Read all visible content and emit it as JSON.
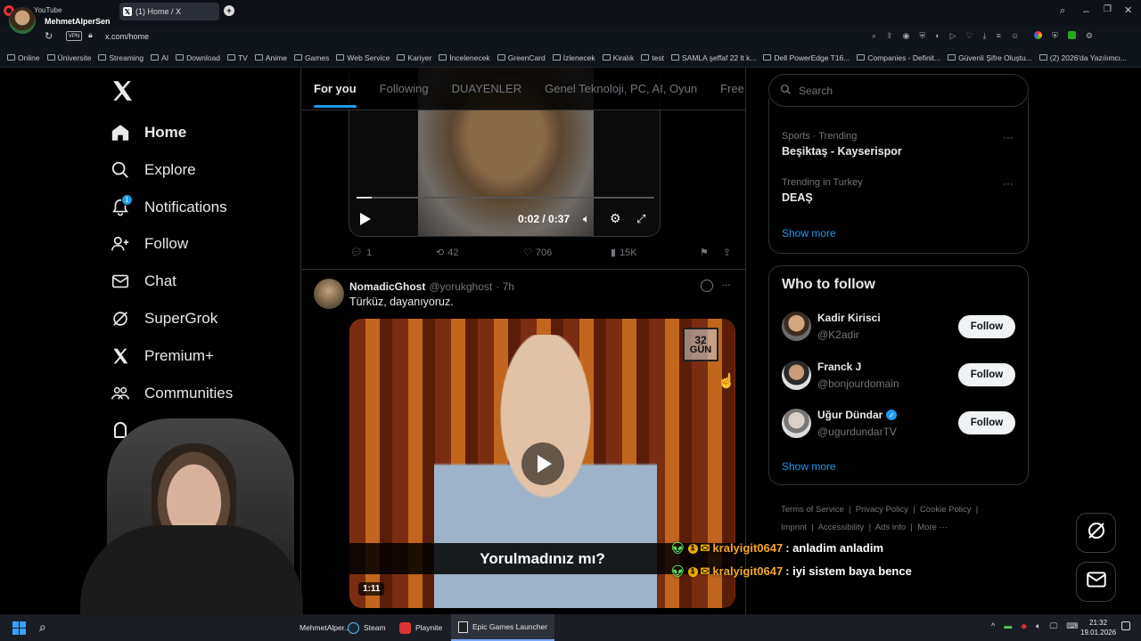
{
  "browser": {
    "profile_top": "YouTube",
    "profile_name": "MehmetAlperSen",
    "tab_title": "(1) Home / X",
    "vpn_badge": "VPN",
    "url": "x.com/home",
    "bookmarks": [
      "Online",
      "Üniversite",
      "Streaming",
      "AI",
      "Download",
      "TV",
      "Anime",
      "Games",
      "Web Service",
      "Kariyer",
      "İncelenecek",
      "GreenCard",
      "İzlenecek",
      "Kiralık",
      "test",
      "SAMLA şeffaf 22 lt k...",
      "Dell PowerEdge T16...",
      "Companies - Definit...",
      "Güvenli Şifre Oluştu...",
      "(2) 2026'da Yazılımcı..."
    ]
  },
  "sidebar": {
    "items": [
      {
        "label": "Home",
        "icon": "home-icon"
      },
      {
        "label": "Explore",
        "icon": "search-icon"
      },
      {
        "label": "Notifications",
        "icon": "bell-icon",
        "badge": "1"
      },
      {
        "label": "Follow",
        "icon": "person-add-icon"
      },
      {
        "label": "Chat",
        "icon": "mail-icon"
      },
      {
        "label": "SuperGrok",
        "icon": "grok-icon"
      },
      {
        "label": "Premium+",
        "icon": "x-logo-icon"
      },
      {
        "label": "Communities",
        "icon": "people-icon"
      }
    ]
  },
  "timeline": {
    "tabs": [
      "For you",
      "Following",
      "DUAYENLER",
      "Genel Teknoloji, PC, AI, Oyun",
      "Free G"
    ],
    "video1": {
      "time": "0:02 / 0:37",
      "progress": 0.05
    },
    "post1_stats": {
      "replies": "1",
      "reposts": "42",
      "likes": "706",
      "views": "15K"
    },
    "post2": {
      "author": "NomadicGhost",
      "handle": "@yorukghost",
      "time": "· 7h",
      "text": "Türküz, dayanıyoruz.",
      "video_caption": "Yorulmadınız mı?",
      "video_logo_top": "32",
      "video_logo_bottom": "GÜN",
      "duration": "1:11"
    }
  },
  "right": {
    "search_placeholder": "Search",
    "trends": [
      {
        "category": "Sports · Trending",
        "name": "Beşiktaş - Kayserispor"
      },
      {
        "category": "Trending in Turkey",
        "name": "DEAŞ"
      }
    ],
    "trends_more": "Show more",
    "who_to_follow_title": "Who to follow",
    "suggestions": [
      {
        "name": "Kadir Kirisci",
        "handle": "@K2adir",
        "button": "Follow",
        "verified": false
      },
      {
        "name": "Franck J",
        "handle": "@bonjourdomain",
        "button": "Follow",
        "verified": false
      },
      {
        "name": "Uğur Dündar",
        "handle": "@ugurdundarTV",
        "button": "Follow",
        "verified": true
      }
    ],
    "follow_more": "Show more",
    "footer_links": [
      "Terms of Service",
      "Privacy Policy",
      "Cookie Policy",
      "Imprint",
      "Accessibility",
      "Ads info",
      "More ···"
    ]
  },
  "chat_overlay": [
    {
      "user": "kralyigit0647",
      "message": ": anladim anladim"
    },
    {
      "user": "kralyigit0647",
      "message": ": iyi sistem baya bence"
    }
  ],
  "taskbar": {
    "apps": [
      "MehmetAlper...",
      "Steam",
      "Playnite",
      "Epic Games Launcher"
    ],
    "time": "21:32",
    "date": "19.01.2026"
  },
  "colors": {
    "accent": "#1d9bf0",
    "border": "#2f3336",
    "muted": "#71767b",
    "chat_user": "#f5a623"
  }
}
